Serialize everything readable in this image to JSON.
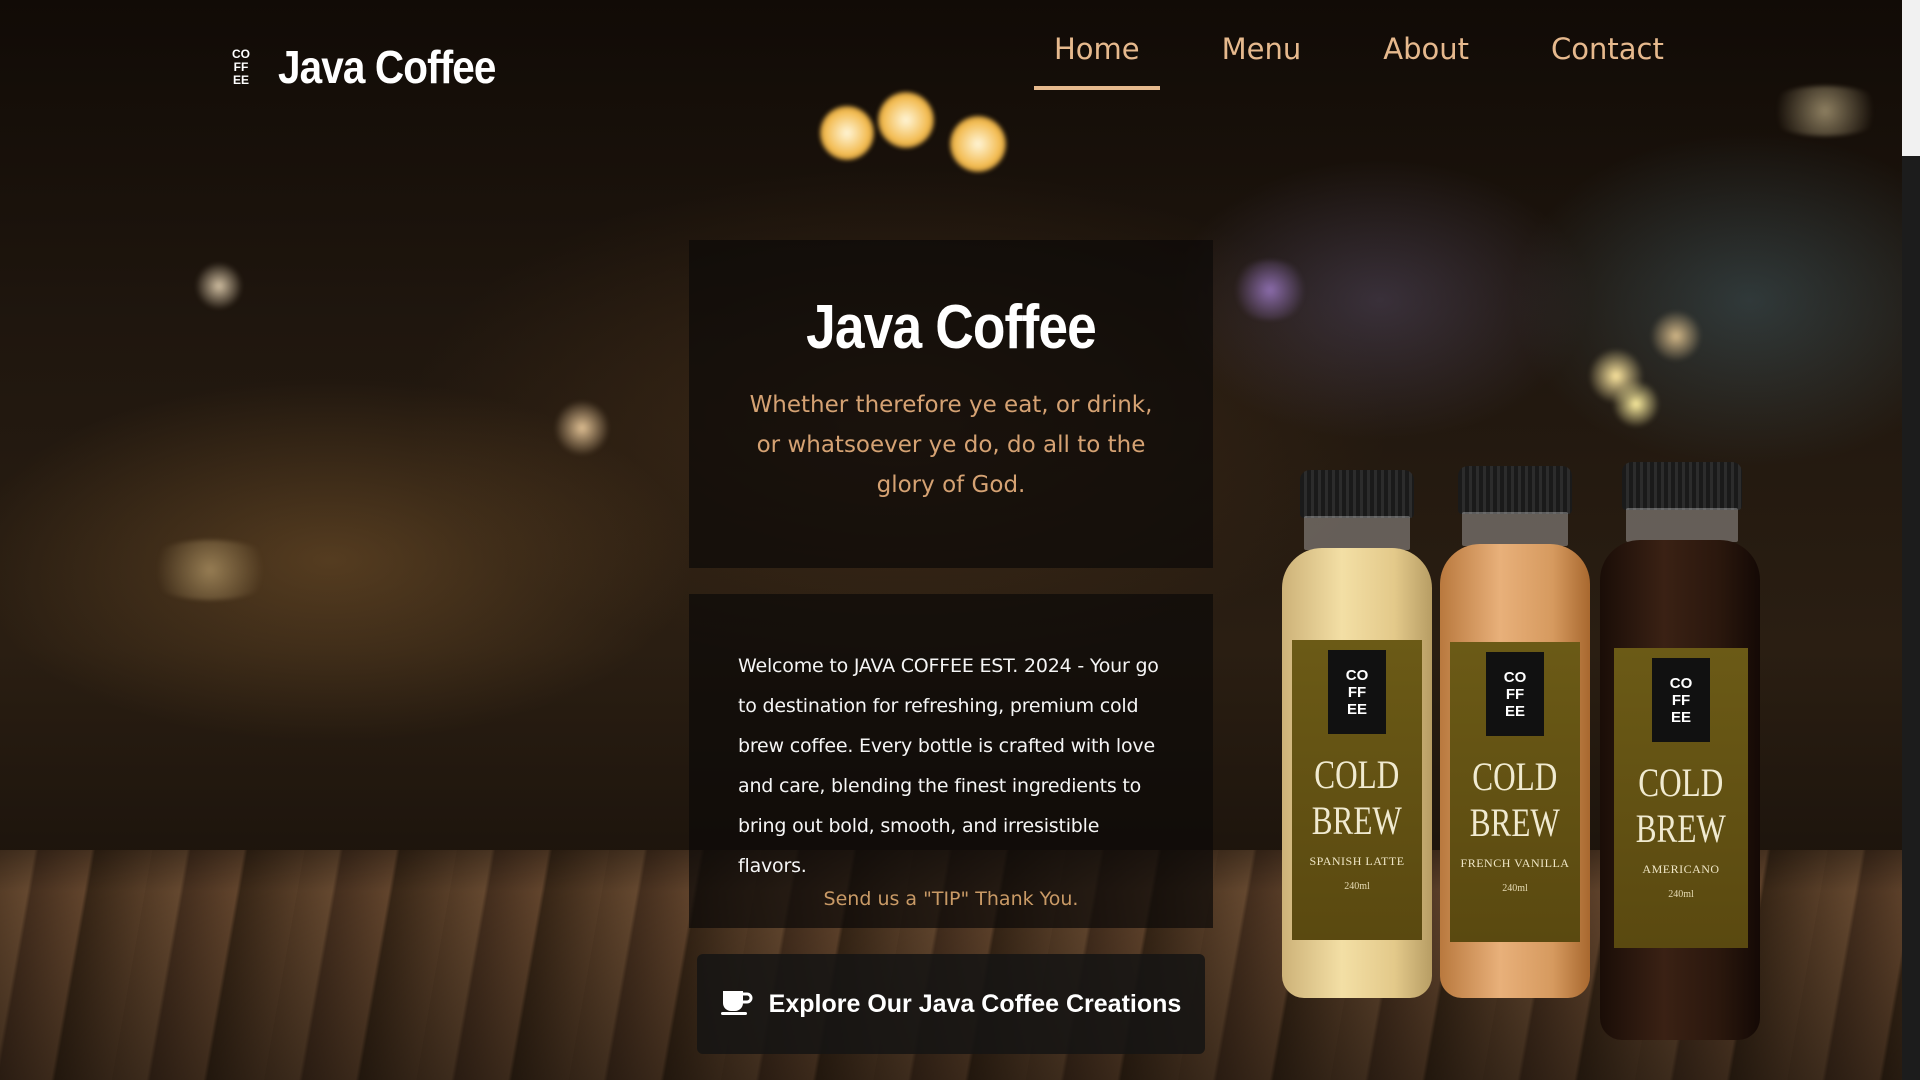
{
  "brand": {
    "name": "Java Coffee",
    "logo_lines": [
      "CO",
      "FF",
      "EE"
    ]
  },
  "nav": {
    "items": [
      {
        "label": "Home",
        "active": true
      },
      {
        "label": "Menu",
        "active": false
      },
      {
        "label": "About",
        "active": false
      },
      {
        "label": "Contact",
        "active": false
      }
    ]
  },
  "hero": {
    "title": "Java Coffee",
    "quote": "Whether therefore ye eat, or drink, or whatsoever ye do, do all to the glory of God."
  },
  "about": {
    "text": "Welcome to JAVA COFFEE EST. 2024 - Your go to destination for refreshing, premium cold brew coffee. Every bottle is crafted with love and care, blending the finest ingredients to bring out bold, smooth, and irresistible flavors.",
    "tip_link": "Send us a \"TIP\" Thank You."
  },
  "cta": {
    "label": "Explore Our Java Coffee Creations",
    "icon": "coffee-cup-icon"
  },
  "products": [
    {
      "title_line1": "COLD",
      "title_line2": "BREW",
      "flavor": "SPANISH LATTE",
      "volume": "240ml"
    },
    {
      "title_line1": "COLD",
      "title_line2": "BREW",
      "flavor": "FRENCH VANILLA",
      "volume": "240ml"
    },
    {
      "title_line1": "COLD",
      "title_line2": "BREW",
      "flavor": "AMERICANO",
      "volume": "240ml"
    }
  ],
  "colors": {
    "accent": "#e6b98d",
    "quote": "#d5a273",
    "link": "#c99a66",
    "panel": "#0c0a09"
  }
}
